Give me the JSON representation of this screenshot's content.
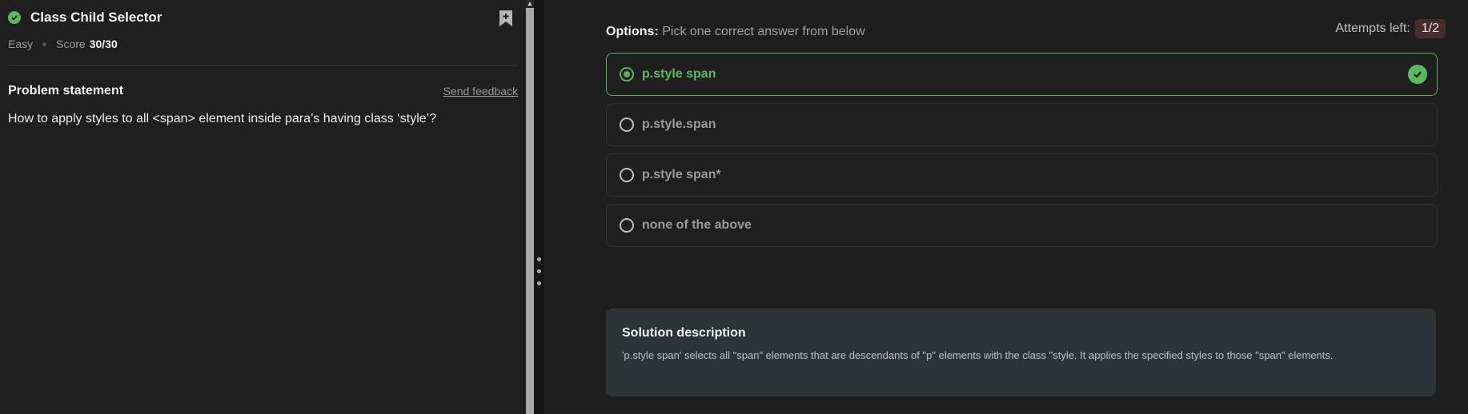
{
  "problem": {
    "title": "Class Child Selector",
    "difficulty": "Easy",
    "score_label": "Score",
    "score_value": "30/30",
    "statement_heading": "Problem statement",
    "feedback_link": "Send feedback",
    "statement": "How to apply styles to all <span> element inside para’s having class ‘style’?"
  },
  "options": {
    "label_bold": "Options:",
    "label_text": " Pick one correct answer from below",
    "attempts_label": "Attempts left:",
    "attempts_value": "1/2",
    "items": [
      {
        "label": "p.style span",
        "selected": true,
        "correct": true
      },
      {
        "label": "p.style.span",
        "selected": false,
        "correct": false
      },
      {
        "label": "p.style span*",
        "selected": false,
        "correct": false
      },
      {
        "label": "none of the above",
        "selected": false,
        "correct": false
      }
    ]
  },
  "solution": {
    "title": "Solution description",
    "text": "'p.style span' selects all \"span\" elements that are descendants of \"p\" elements with the class \"style. It applies the specified styles to those \"span\" elements."
  },
  "icons": {
    "solved": "check-circle-icon",
    "bookmark": "bookmark-add-icon",
    "correct": "check-circle-icon",
    "resize": "drag-handle-icon"
  },
  "colors": {
    "accent_green": "#5cb85c",
    "attempts_badge": "#4a2a2a",
    "solution_bg": "#2b3436"
  }
}
